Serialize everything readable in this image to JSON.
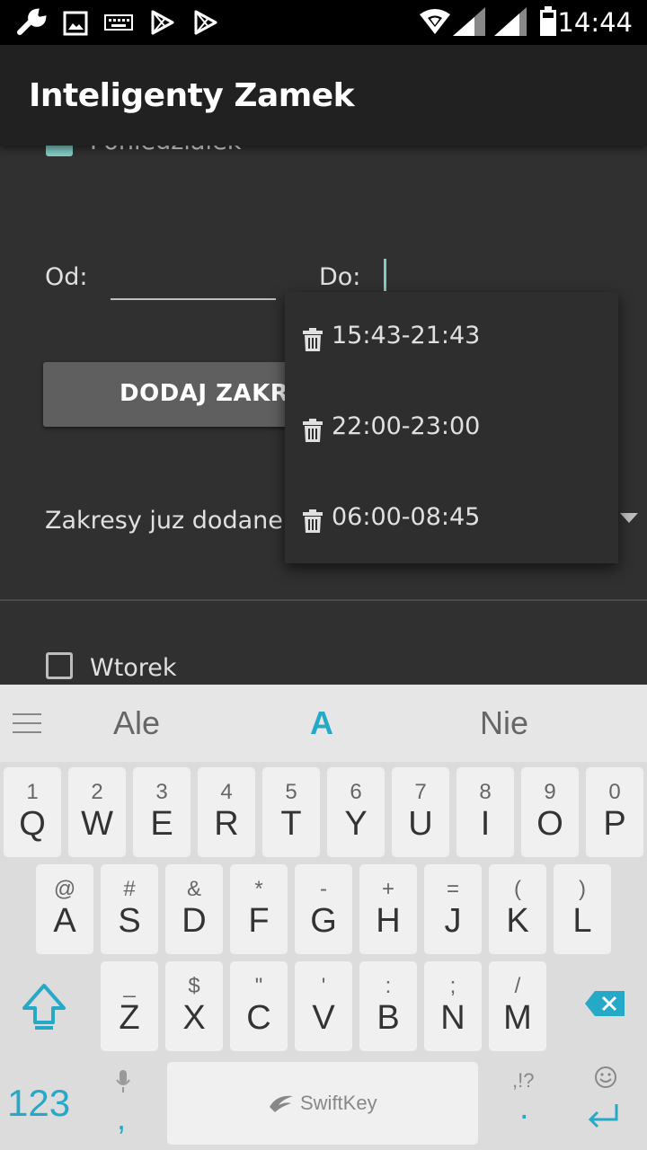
{
  "status_bar": {
    "time": "14:44"
  },
  "app_bar": {
    "title": "Inteligenty Zamek"
  },
  "form": {
    "day_checked_label": "Poniedziałek",
    "from_label": "Od:",
    "to_label": "Do:",
    "add_button_label": "DODAJ ZAKRES",
    "ranges_label": "Zakresy juz dodane",
    "next_day_label": "Wtorek"
  },
  "dropdown": {
    "items": [
      {
        "range": "15:43-21:43"
      },
      {
        "range": "22:00-23:00"
      },
      {
        "range": "06:00-08:45"
      }
    ]
  },
  "keyboard": {
    "suggestions": [
      "Ale",
      "A",
      "Nie"
    ],
    "row1": [
      {
        "sec": "1",
        "pri": "Q"
      },
      {
        "sec": "2",
        "pri": "W"
      },
      {
        "sec": "3",
        "pri": "E"
      },
      {
        "sec": "4",
        "pri": "R"
      },
      {
        "sec": "5",
        "pri": "T"
      },
      {
        "sec": "6",
        "pri": "Y"
      },
      {
        "sec": "7",
        "pri": "U"
      },
      {
        "sec": "8",
        "pri": "I"
      },
      {
        "sec": "9",
        "pri": "O"
      },
      {
        "sec": "0",
        "pri": "P"
      }
    ],
    "row2": [
      {
        "sec": "@",
        "pri": "A"
      },
      {
        "sec": "#",
        "pri": "S"
      },
      {
        "sec": "&",
        "pri": "D"
      },
      {
        "sec": "*",
        "pri": "F"
      },
      {
        "sec": "-",
        "pri": "G"
      },
      {
        "sec": "+",
        "pri": "H"
      },
      {
        "sec": "=",
        "pri": "J"
      },
      {
        "sec": "(",
        "pri": "K"
      },
      {
        "sec": ")",
        "pri": "L"
      }
    ],
    "row3": [
      {
        "sec": "_",
        "pri": "Z"
      },
      {
        "sec": "$",
        "pri": "X"
      },
      {
        "sec": "\"",
        "pri": "C"
      },
      {
        "sec": "'",
        "pri": "V"
      },
      {
        "sec": ":",
        "pri": "B"
      },
      {
        "sec": ";",
        "pri": "N"
      },
      {
        "sec": "/",
        "pri": "M"
      }
    ],
    "numbers_key": "123",
    "comma_key": ",",
    "space_brand": "SwiftKey",
    "punct_sec": ",!?",
    "period_key": "."
  },
  "colors": {
    "accent": "#26a9c6",
    "checkbox_checked": "#80cbc4"
  }
}
